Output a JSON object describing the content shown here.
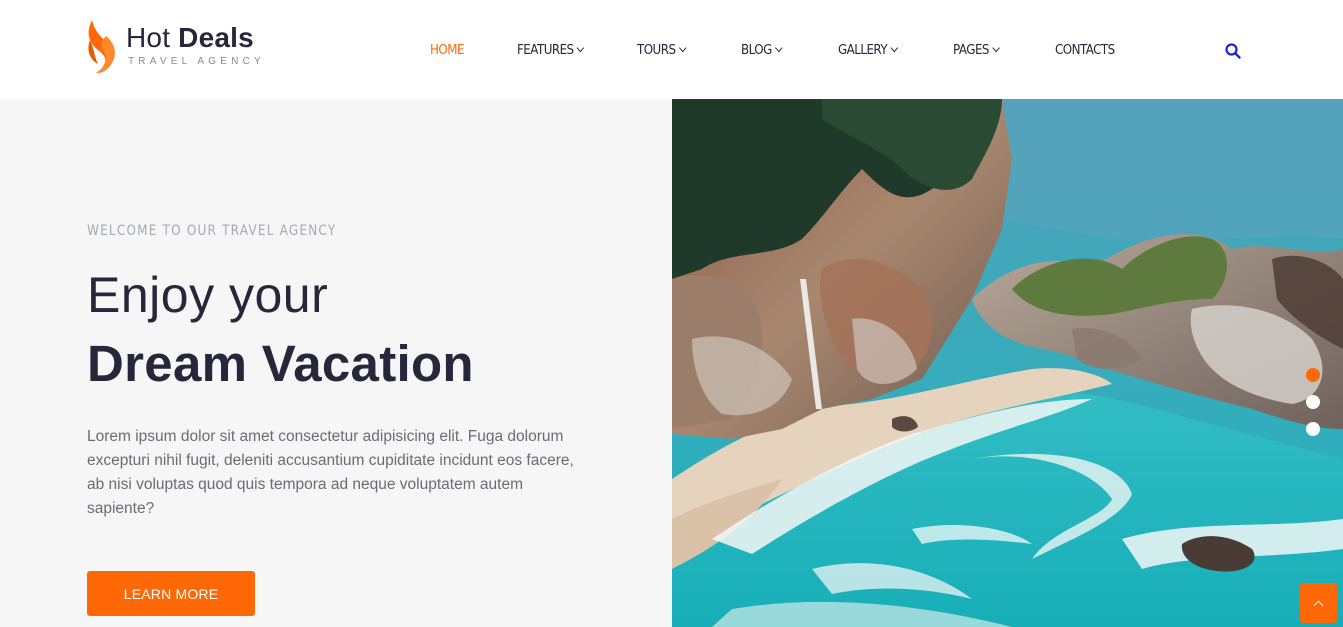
{
  "brand": {
    "name_light": "Hot ",
    "name_bold": "Deals",
    "tagline": "TRAVEL AGENCY",
    "accent_color": "#ff6806",
    "dark_color": "#27263a"
  },
  "nav": {
    "items": [
      {
        "label": "HOME",
        "active": true,
        "dropdown": false
      },
      {
        "label": "FEATURES",
        "active": false,
        "dropdown": true
      },
      {
        "label": "TOURS",
        "active": false,
        "dropdown": true
      },
      {
        "label": "BLOG",
        "active": false,
        "dropdown": true
      },
      {
        "label": "GALLERY",
        "active": false,
        "dropdown": true
      },
      {
        "label": "PAGES",
        "active": false,
        "dropdown": true
      },
      {
        "label": "CONTACTS",
        "active": false,
        "dropdown": false
      }
    ],
    "search_icon": "search-icon",
    "search_color": "#1a23d6"
  },
  "hero": {
    "eyebrow": "WELCOME TO OUR TRAVEL AGENCY",
    "headline_line1": "Enjoy your",
    "headline_line2": "Dream Vacation",
    "description": "Lorem ipsum dolor sit amet consectetur adipisicing elit. Fuga dolorum excepturi nihil fugit, deleniti accusantium cupiditate incidunt eos facere, ab nisi voluptas quod quis tempora ad neque voluptatem autem sapiente?",
    "cta_label": "LEARN MORE",
    "slider": {
      "count": 3,
      "active_index": 0
    }
  },
  "scroll_top_icon": "chevron-up-icon"
}
